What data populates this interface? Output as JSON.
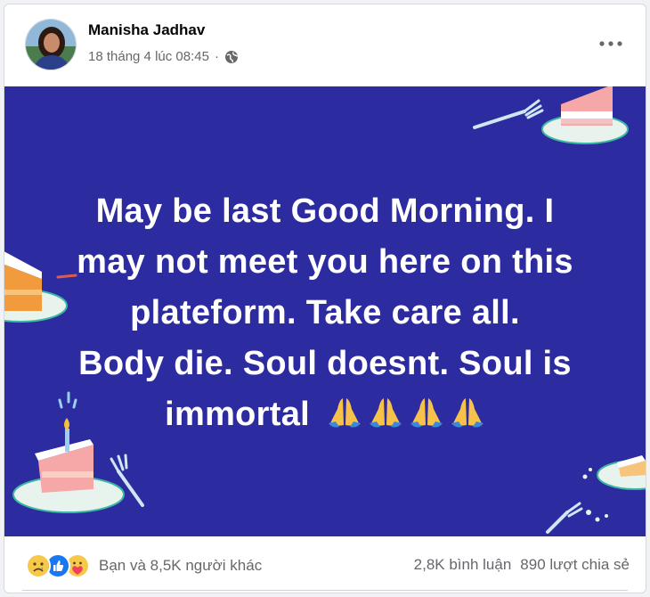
{
  "post": {
    "author": "Manisha Jadhav",
    "timestamp": "18 tháng 4 lúc 08:45",
    "privacy_icon": "globe-icon",
    "menu_icon": "more-options-icon",
    "background_color": "#2d2ba0",
    "text_lines": [
      "May be last Good Morning. I",
      "may not meet you here on this",
      "plateform. Take care all.",
      "Body die. Soul doesnt. Soul is",
      "immortal"
    ],
    "emoji": [
      "folded-hands",
      "folded-hands",
      "folded-hands",
      "folded-hands"
    ]
  },
  "footer": {
    "reaction_icons": [
      "sad-icon",
      "like-icon",
      "care-icon"
    ],
    "reaction_label": "Bạn và 8,5K người khác",
    "comments": "2,8K bình luận",
    "shares": "890 lượt chia sẻ"
  }
}
